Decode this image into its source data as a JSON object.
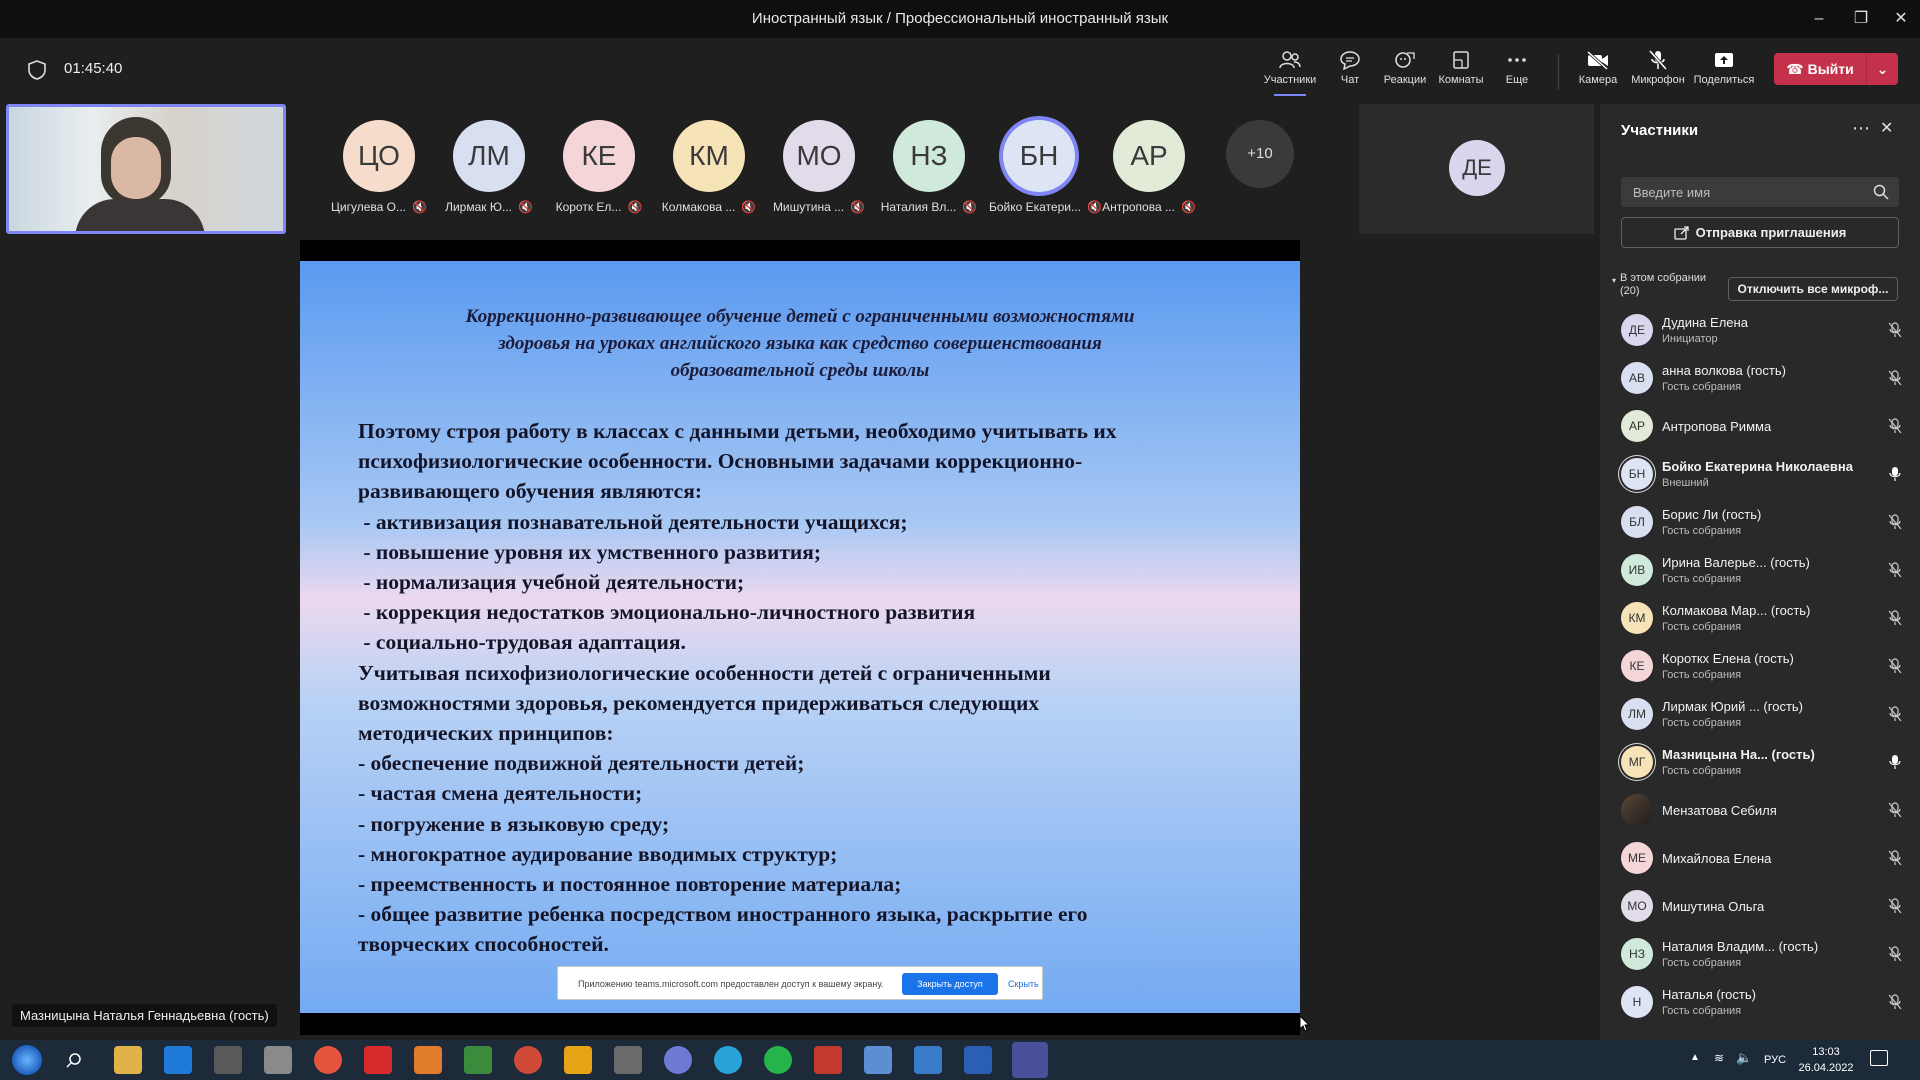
{
  "window": {
    "title": "Иностранный язык / Профессиональный иностранный язык"
  },
  "meeting": {
    "timer": "01:45:40"
  },
  "toolbar": {
    "participants": "Участники",
    "chat": "Чат",
    "reactions": "Реакции",
    "rooms": "Комнаты",
    "more": "Еще",
    "camera": "Камера",
    "mic": "Микрофон",
    "share": "Поделиться",
    "leave": "Выйти"
  },
  "avatars": [
    {
      "initials": "ЦО",
      "name": "Цигулева О...",
      "color": "#f6dccb"
    },
    {
      "initials": "ЛМ",
      "name": "Лирмак Ю...",
      "color": "#d7dff0"
    },
    {
      "initials": "КЕ",
      "name": "Коротк Ел...",
      "color": "#f4d6d9"
    },
    {
      "initials": "КМ",
      "name": "Колмакова ...",
      "color": "#f7e3b8"
    },
    {
      "initials": "МО",
      "name": "Мишутина ...",
      "color": "#e2dcea"
    },
    {
      "initials": "НЗ",
      "name": "Наталия Вл...",
      "color": "#cfe9da"
    },
    {
      "initials": "БН",
      "name": "Бойко Екатери...",
      "color": "#dde4f4"
    },
    {
      "initials": "АР",
      "name": "Антропова ...",
      "color": "#e2ead8"
    }
  ],
  "more_count": "+10",
  "tile": {
    "initials": "ДЕ"
  },
  "slide": {
    "title": [
      "Коррекционно-развивающее обучение детей с ограниченными возможностями",
      "здоровья на уроках английского языка как средство совершенствования",
      "образовательной среды школы"
    ],
    "lines": [
      "Поэтому строя работу в классах с данными детьми, необходимо учитывать их",
      "психофизиологические особенности. Основными задачами коррекционно-",
      "развивающего обучения являются:",
      " - активизация познавательной деятельности учащихся;",
      " - повышение уровня их умственного развития;",
      " - нормализация учебной деятельности;",
      " - коррекция недостатков эмоционально-личностного развития",
      " - социально-трудовая адаптация.",
      "Учитывая психофизиологические особенности детей с ограниченными",
      "возможностями здоровья, рекомендуется придерживаться следующих",
      "методических принципов:",
      "- обеспечение подвижной деятельности детей;",
      "- частая смена деятельности;",
      "- погружение в языковую среду;",
      "- многократное аудирование вводимых структур;",
      "- преемственность и постоянное повторение материала;",
      "- общее развитие ребенка посредством иностранного языка, раскрытие его",
      "творческих способностей."
    ],
    "notice": {
      "text": "Приложению teams.microsoft.com предоставлен доступ к вашему экрану.",
      "stop": "Закрыть доступ",
      "hide": "Скрыть"
    }
  },
  "self_label": "Мазницына Наталья Геннадьевна (гость)",
  "panel": {
    "title": "Участники",
    "search_placeholder": "Введите имя",
    "invite": "Отправка приглашения",
    "section": "В этом собрании",
    "section_count": "(20)",
    "mute_all": "Отключить все микроф...",
    "people": [
      {
        "initials": "ДЕ",
        "name": "Дудина Елена",
        "sub": "Инициатор",
        "color": "#dcd5ee",
        "mic": "off"
      },
      {
        "initials": "АВ",
        "name": "анна волкова (гость)",
        "sub": "Гость собрания",
        "color": "#d7dff0",
        "mic": "off"
      },
      {
        "initials": "АР",
        "name": "Антропова Римма",
        "sub": "",
        "color": "#e2ead8",
        "mic": "off"
      },
      {
        "initials": "БН",
        "name": "Бойко Екатерина Николаевна",
        "sub": "Внешний",
        "color": "#dde4f4",
        "mic": "on",
        "bold": true,
        "ring": true
      },
      {
        "initials": "БЛ",
        "name": "Борис Ли (гость)",
        "sub": "Гость собрания",
        "color": "#d7dff0",
        "mic": "off"
      },
      {
        "initials": "ИВ",
        "name": "Ирина Валерье...  (гость)",
        "sub": "Гость собрания",
        "color": "#cfe9da",
        "mic": "off"
      },
      {
        "initials": "КМ",
        "name": "Колмакова Мар...  (гость)",
        "sub": "Гость собрания",
        "color": "#f7e3b8",
        "mic": "off"
      },
      {
        "initials": "КЕ",
        "name": "Короткх Елена (гость)",
        "sub": "Гость собрания",
        "color": "#f4d6d9",
        "mic": "off"
      },
      {
        "initials": "ЛМ",
        "name": "Лирмак Юрий ...   (гость)",
        "sub": "Гость собрания",
        "color": "#d7dff0",
        "mic": "off"
      },
      {
        "initials": "МГ",
        "name": "Мазницына На...  (гость)",
        "sub": "Гость собрания",
        "color": "#f7e3b8",
        "mic": "on",
        "bold": true,
        "ring": true
      },
      {
        "initials": "",
        "name": "Мензатова Себиля",
        "sub": "",
        "color": "#3a3a3a",
        "mic": "off",
        "photo": true
      },
      {
        "initials": "МЕ",
        "name": "Михайлова Елена",
        "sub": "",
        "color": "#f4d6d9",
        "mic": "off"
      },
      {
        "initials": "МО",
        "name": "Мишутина Ольга",
        "sub": "",
        "color": "#e2dcea",
        "mic": "off"
      },
      {
        "initials": "НЗ",
        "name": "Наталия Владим... (гость)",
        "sub": "Гость собрания",
        "color": "#cfe9da",
        "mic": "off"
      },
      {
        "initials": "Н",
        "name": "Наталья (гость)",
        "sub": "Гость собрания",
        "color": "#dde4f4",
        "mic": "off"
      }
    ]
  },
  "taskbar": {
    "lang": "РУС",
    "time": "13:03",
    "date": "26.04.2022"
  }
}
